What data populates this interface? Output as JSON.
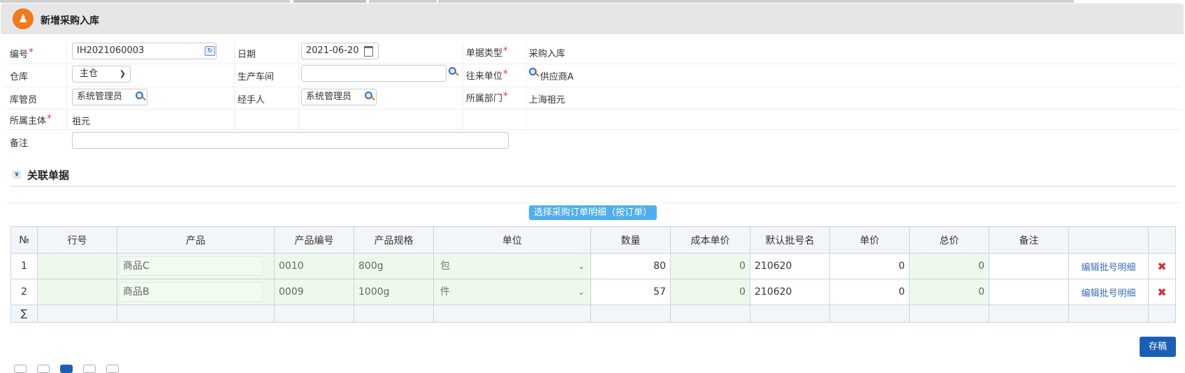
{
  "header": {
    "title": "新增采购入库"
  },
  "form": {
    "labels": {
      "code": "编号",
      "date": "日期",
      "doc_type": "单据类型",
      "warehouse": "仓库",
      "workshop": "生产车间",
      "partner": "往来单位",
      "keeper": "库管员",
      "handler": "经手人",
      "department": "所属部门",
      "entity": "所属主体",
      "remark": "备注"
    },
    "values": {
      "code": "IH2021060003",
      "date": "2021-06-20",
      "doc_type": "采购入库",
      "warehouse": "主仓",
      "workshop": "",
      "partner": "供应商A",
      "keeper": "系统管理员",
      "handler": "系统管理员",
      "department": "上海祖元",
      "entity": "祖元",
      "remark": ""
    },
    "required_mark": "*"
  },
  "section": {
    "title": "关联单据"
  },
  "select_button": "选择采购订单明细（按订单）",
  "grid": {
    "columns": [
      "№",
      "行号",
      "产品",
      "产品编号",
      "产品规格",
      "单位",
      "数量",
      "成本单价",
      "默认批号名",
      "单价",
      "总价",
      "备注",
      "",
      ""
    ],
    "rows": [
      {
        "no": "1",
        "line": "",
        "product": "商品C",
        "code": "0010",
        "spec": "800g",
        "unit": "包",
        "qty": "80",
        "cost": "0",
        "batch": "210620",
        "price": "0",
        "total": "0",
        "remark": "",
        "action": "编辑批号明细"
      },
      {
        "no": "2",
        "line": "",
        "product": "商品B",
        "code": "0009",
        "spec": "1000g",
        "unit": "件",
        "qty": "57",
        "cost": "0",
        "batch": "210620",
        "price": "0",
        "total": "0",
        "remark": "",
        "action": "编辑批号明细"
      }
    ],
    "sum_symbol": "∑"
  },
  "footer": {
    "save": "存稿"
  },
  "icons": {
    "logo": "user-badge-icon",
    "lookup": "search-icon",
    "calendar": "calendar-icon",
    "delete": "close-icon"
  },
  "colors": {
    "accent": "#1a5fb4",
    "select_button": "#4eaef0",
    "required": "#e33333",
    "editable_cell": "#eef9ec"
  }
}
